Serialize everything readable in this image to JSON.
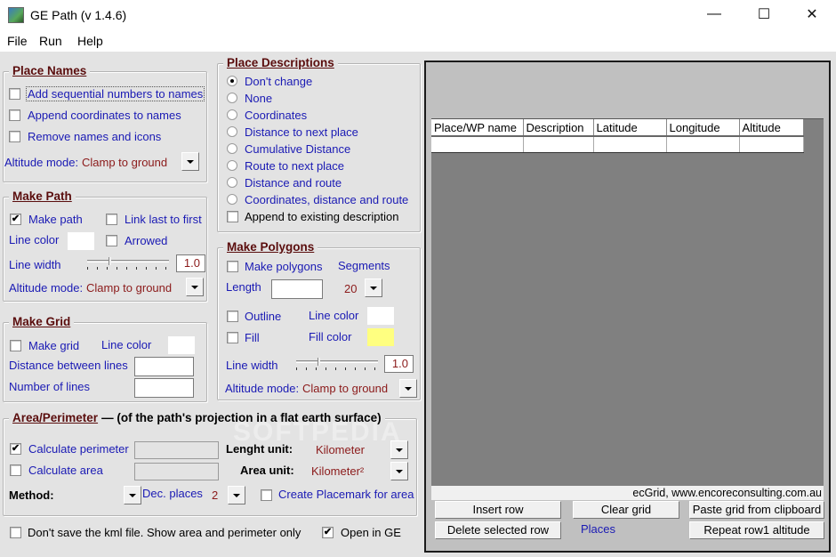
{
  "window": {
    "title": "GE Path (v 1.4.6)",
    "controls": {
      "minimize": "—",
      "maximize": "☐",
      "close": "✕"
    }
  },
  "menu": [
    "File",
    "Run",
    "Help"
  ],
  "place_names": {
    "title": "Place Names",
    "options": [
      {
        "label": "Add sequential numbers to names",
        "checked": false,
        "focused": true
      },
      {
        "label": "Append coordinates to names",
        "checked": false
      },
      {
        "label": "Remove names and icons",
        "checked": false
      }
    ],
    "altitude_label": "Altitude mode:",
    "altitude_value": "Clamp to ground"
  },
  "make_path": {
    "title": "Make Path",
    "make_path_label": "Make path",
    "make_path_checked": true,
    "link_label": "Link last to first",
    "link_checked": false,
    "line_color_label": "Line color",
    "line_color": "#ffffff",
    "arrowed_label": "Arrowed",
    "arrowed_checked": false,
    "line_width_label": "Line width",
    "line_width_value": "1.0",
    "altitude_label": "Altitude mode:",
    "altitude_value": "Clamp to ground"
  },
  "make_grid": {
    "title": "Make Grid",
    "make_grid_label": "Make grid",
    "make_grid_checked": false,
    "line_color_label": "Line color",
    "line_color": "#ffffff",
    "distance_label": "Distance between lines",
    "distance_value": "",
    "number_label": "Number of  lines",
    "number_value": ""
  },
  "area": {
    "title": "Area/Perimeter",
    "subtitle": "(of the path's projection in a flat earth surface)",
    "perimeter_label": "Calculate perimeter",
    "perimeter_checked": true,
    "area_label": "Calculate area",
    "area_checked": false,
    "length_unit_label": "Lenght unit:",
    "length_unit_value": "Kilometer",
    "area_unit_label": "Area unit:",
    "area_unit_value": "Kilometer²",
    "method_label": "Method:",
    "dec_places_label": "Dec. places",
    "dec_places_value": "2",
    "placemark_label": "Create Placemark for area",
    "placemark_checked": false
  },
  "place_descriptions": {
    "title": "Place Descriptions",
    "options": [
      {
        "label": "Don't change",
        "selected": true
      },
      {
        "label": "None",
        "selected": false
      },
      {
        "label": "Coordinates",
        "selected": false
      },
      {
        "label": "Distance to next place",
        "selected": false
      },
      {
        "label": "Cumulative Distance",
        "selected": false
      },
      {
        "label": "Route to next place",
        "selected": false
      },
      {
        "label": "Distance and route",
        "selected": false
      },
      {
        "label": "Coordinates, distance and route",
        "selected": false
      }
    ],
    "append_label": "Append to existing description",
    "append_checked": false
  },
  "make_polygons": {
    "title": "Make Polygons",
    "make_polygons_label": "Make polygons",
    "make_polygons_checked": false,
    "segments_label": "Segments",
    "segments_value": "20",
    "length_label": "Length",
    "length_value": "",
    "outline_label": "Outline",
    "outline_checked": false,
    "line_color_label": "Line color",
    "line_color": "#ffffff",
    "fill_label": "Fill",
    "fill_checked": false,
    "fill_color_label": "Fill color",
    "fill_color": "#ffff80",
    "line_width_label": "Line width",
    "line_width_value": "1.0",
    "altitude_label": "Altitude mode:",
    "altitude_value": "Clamp to ground"
  },
  "bottom": {
    "dont_save_label": "Don't save the kml file. Show area and perimeter only",
    "dont_save_checked": false,
    "open_ge_label": "Open in GE",
    "open_ge_checked": true
  },
  "grid_panel": {
    "columns": [
      "Place/WP name",
      "Description",
      "Latitude",
      "Longitude",
      "Altitude"
    ],
    "rows": [
      [
        "",
        "",
        "",
        "",
        ""
      ]
    ],
    "credit": "ecGrid,  www.encoreconsulting.com.au",
    "buttons": {
      "insert_row": "Insert row",
      "clear_grid": "Clear grid",
      "paste_grid": "Paste grid from clipboard",
      "delete_row": "Delete selected row",
      "repeat_altitude": "Repeat row1 altitude"
    },
    "places_label": "Places"
  },
  "watermark": "SOFTPEDIA"
}
